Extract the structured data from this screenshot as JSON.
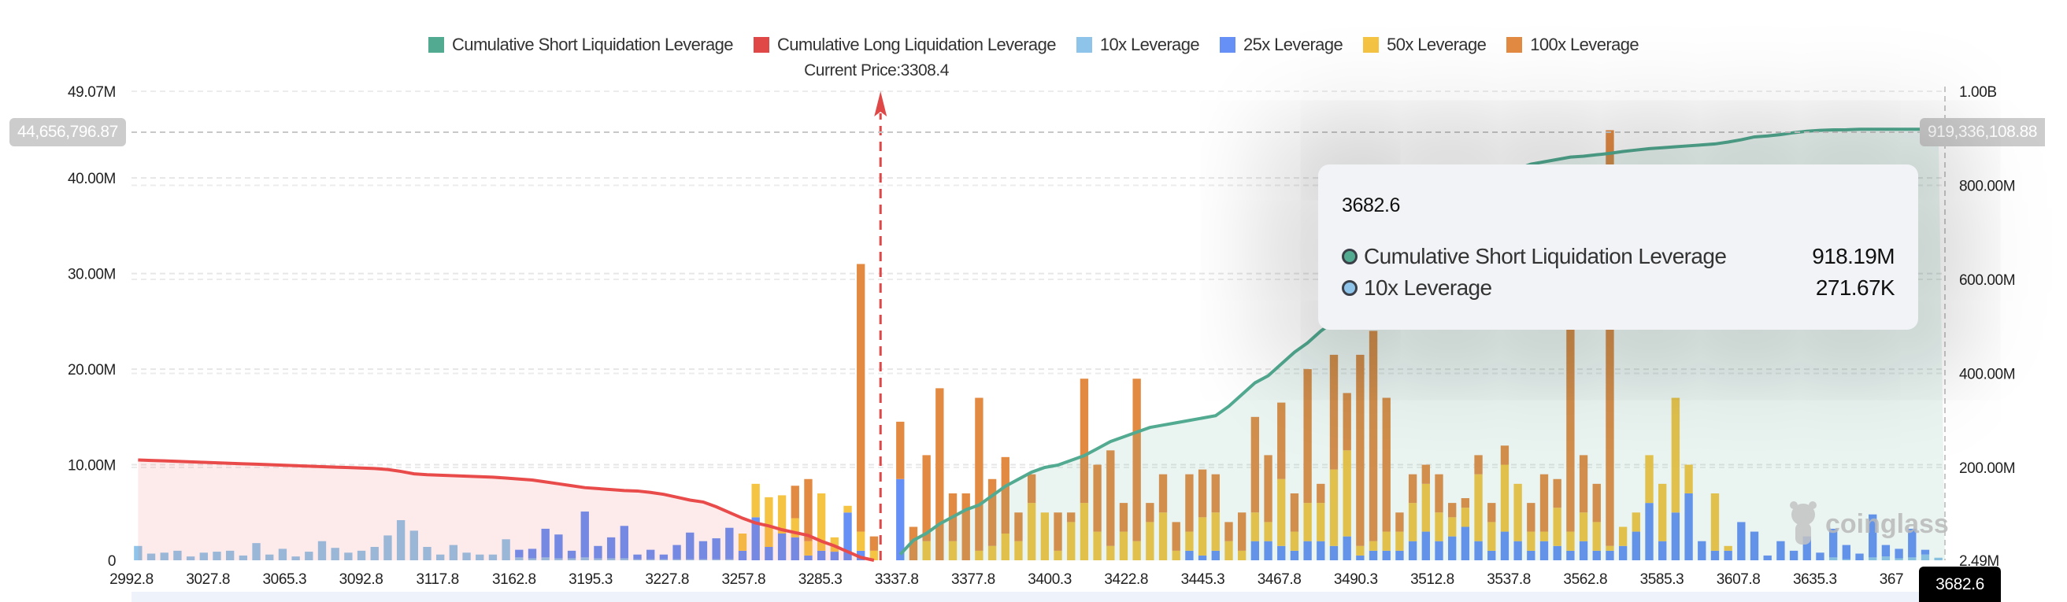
{
  "chart_data": {
    "type": "bar",
    "stacked": true,
    "legend_position": "top",
    "legend": [
      {
        "label": "Cumulative Short Liquidation Leverage",
        "color": "#52ab91"
      },
      {
        "label": "Cumulative Long Liquidation Leverage",
        "color": "#e04848"
      },
      {
        "label": "10x Leverage",
        "color": "#8fc4ea"
      },
      {
        "label": "25x Leverage",
        "color": "#6690f5"
      },
      {
        "label": "50x Leverage",
        "color": "#f5c443"
      },
      {
        "label": "100x Leverage",
        "color": "#e38a42"
      }
    ],
    "current_price_label": "Current Price:3308.4",
    "left_axis": {
      "ticks": [
        "0",
        "10.00M",
        "20.00M",
        "30.00M",
        "40.00M",
        "49.07M"
      ],
      "values": [
        0,
        10,
        20,
        30,
        40,
        49.07
      ],
      "range": [
        0,
        49.07
      ],
      "unit": "M"
    },
    "right_axis": {
      "ticks": [
        "2.49M",
        "200.00M",
        "400.00M",
        "600.00M",
        "800.00M",
        "1.00B"
      ],
      "values": [
        2.49,
        200,
        400,
        600,
        800,
        1000
      ],
      "range": [
        2.49,
        1000
      ],
      "unit": "M"
    },
    "x_ticks": [
      "2992.8",
      "3027.8",
      "3065.3",
      "3092.8",
      "3117.8",
      "3162.8",
      "3195.3",
      "3227.8",
      "3257.8",
      "3285.3",
      "3337.8",
      "3377.8",
      "3400.3",
      "3422.8",
      "3445.3",
      "3467.8",
      "3490.3",
      "3512.8",
      "3537.8",
      "3562.8",
      "3585.3",
      "3607.8",
      "3635.3",
      "367"
    ],
    "grid": true,
    "crosshair": {
      "x_label": "3682.6",
      "left_value": "44,656,796.87",
      "right_value": "919,336,108.88"
    },
    "series": [
      {
        "name": "10x Leverage",
        "axis": "left",
        "values": [
          1.5,
          0.7,
          0.8,
          1,
          0.4,
          0.8,
          0.9,
          1,
          0.5,
          1.8,
          0.6,
          1.2,
          0.4,
          0.9,
          2,
          1.3,
          0.8,
          1,
          1.4,
          2.6,
          4.2,
          3.1,
          1.4,
          0.6,
          1.6,
          0.8,
          0.6,
          0.6,
          2.2,
          0.3,
          0.2,
          0.3,
          0.2,
          0.2,
          0.3,
          0.2,
          0.2,
          0.2,
          0.1,
          0.1,
          0.1,
          0.1,
          0.1,
          0.1,
          0.1,
          0.1,
          0,
          0,
          0,
          0,
          0,
          0,
          0,
          0,
          0,
          0,
          0,
          0,
          0,
          0,
          0,
          0,
          0,
          0,
          0,
          0,
          0,
          0,
          0,
          0,
          0,
          0,
          0,
          0,
          0,
          0,
          0,
          0,
          0,
          0,
          0,
          0,
          0,
          0,
          0,
          0,
          0,
          0,
          0,
          0,
          0,
          0,
          0,
          0,
          0,
          0,
          0,
          0,
          0,
          0,
          0,
          0,
          0,
          0,
          0,
          0,
          0,
          0,
          0,
          0,
          0,
          0,
          0,
          0,
          0,
          0,
          0,
          0,
          0,
          0,
          0,
          0,
          0,
          0,
          0,
          0,
          0,
          0,
          0,
          0.3,
          0.1,
          0,
          0.3,
          0.4,
          0.2,
          0.3,
          0.6,
          0.27
        ]
      },
      {
        "name": "25x Leverage",
        "axis": "left",
        "values": [
          0,
          0,
          0,
          0,
          0,
          0,
          0,
          0,
          0,
          0,
          0,
          0,
          0,
          0,
          0,
          0,
          0,
          0,
          0,
          0,
          0,
          0,
          0,
          0,
          0,
          0,
          0,
          0,
          0,
          0.8,
          1,
          3,
          2.5,
          0.8,
          4.8,
          1.3,
          2.2,
          3.4,
          0.5,
          1,
          0.5,
          1.5,
          2.8,
          1.9,
          2.2,
          3.3,
          1,
          4.5,
          1.4,
          2.8,
          2.4,
          0.5,
          1,
          0.9,
          5,
          1,
          0,
          0,
          8.5,
          0,
          0,
          0,
          0,
          0,
          0,
          0,
          0,
          0,
          0,
          0,
          0,
          0,
          0,
          0,
          0,
          0,
          0,
          0,
          0,
          0,
          1,
          0.5,
          1,
          0,
          0,
          2,
          2,
          1.5,
          1,
          2,
          2,
          1.5,
          2.5,
          0.5,
          1,
          1,
          1,
          2,
          3,
          2,
          2.5,
          3.5,
          2,
          1,
          3,
          2,
          1,
          2,
          1.5,
          1,
          2,
          1,
          1,
          1.5,
          3,
          6,
          2,
          5,
          7,
          2,
          1,
          1,
          4,
          3,
          0.5,
          2,
          1,
          2.5,
          0.8,
          3,
          1.5,
          0.7,
          4.5,
          1.2,
          1,
          3,
          0.5,
          0
        ]
      },
      {
        "name": "50x Leverage",
        "axis": "left",
        "values": [
          0,
          0,
          0,
          0,
          0,
          0,
          0,
          0,
          0,
          0,
          0,
          0,
          0,
          0,
          0,
          0,
          0,
          0,
          0,
          0,
          0,
          0,
          0,
          0,
          0,
          0,
          0,
          0,
          0,
          0,
          0,
          0,
          0,
          0,
          0,
          0,
          0,
          0,
          0,
          0,
          0,
          0,
          0,
          0,
          0,
          0,
          1.8,
          3.5,
          5.2,
          4,
          2,
          1.5,
          6,
          1.5,
          0.7,
          2,
          1,
          0,
          0,
          0,
          2,
          0,
          2,
          0,
          1,
          1.5,
          2.8,
          2,
          6,
          5,
          1,
          4,
          6,
          3,
          1.5,
          3,
          2,
          4,
          5,
          1,
          2,
          4,
          4,
          2,
          1,
          3,
          2,
          7,
          2,
          4,
          4,
          8,
          9,
          1,
          1,
          2,
          2,
          4,
          5,
          3,
          2,
          2,
          7,
          3,
          7,
          6,
          2,
          1,
          4,
          2,
          3,
          3,
          0.5,
          2,
          2,
          5,
          6,
          12,
          3,
          0,
          6,
          0.5,
          0,
          0,
          0,
          0,
          0,
          0,
          0,
          0,
          0,
          0,
          0,
          0,
          0,
          0,
          0,
          0
        ]
      },
      {
        "name": "100x Leverage",
        "axis": "left",
        "values": [
          0,
          0,
          0,
          0,
          0,
          0,
          0,
          0,
          0,
          0,
          0,
          0,
          0,
          0,
          0,
          0,
          0,
          0,
          0,
          0,
          0,
          0,
          0,
          0,
          0,
          0,
          0,
          0,
          0,
          0,
          0,
          0,
          0,
          0,
          0,
          0,
          0,
          0,
          0,
          0,
          0,
          0,
          0,
          0,
          0,
          0,
          0,
          0,
          0,
          0,
          3.4,
          6.5,
          0,
          0,
          0,
          28,
          1.5,
          0,
          6,
          3.5,
          9,
          18,
          5,
          7,
          16,
          7,
          8,
          3,
          3,
          0,
          4,
          1,
          13,
          7,
          10,
          3,
          17,
          2,
          4,
          3,
          6,
          5,
          4,
          2,
          4,
          10,
          7,
          8,
          4,
          14,
          2,
          12,
          6,
          20,
          22,
          14,
          2,
          3,
          2,
          4,
          1.5,
          1,
          2,
          2,
          2,
          0,
          3,
          6,
          3,
          22,
          6,
          4,
          43.5,
          0,
          0,
          0,
          0,
          0,
          0,
          0,
          0,
          0,
          0,
          0,
          0,
          0,
          0,
          0,
          0,
          0,
          0,
          0,
          0,
          0,
          0,
          0
        ]
      },
      {
        "name": "Cumulative Long Liquidation Leverage",
        "axis": "left",
        "type": "line",
        "values": [
          10.5,
          10.45,
          10.4,
          10.35,
          10.3,
          10.25,
          10.2,
          10.15,
          10.1,
          10.05,
          10,
          9.95,
          9.9,
          9.85,
          9.8,
          9.75,
          9.7,
          9.65,
          9.6,
          9.5,
          9.3,
          9.05,
          8.95,
          8.9,
          8.85,
          8.8,
          8.75,
          8.7,
          8.6,
          8.5,
          8.4,
          8.2,
          8.0,
          7.8,
          7.6,
          7.5,
          7.4,
          7.3,
          7.25,
          7.1,
          6.9,
          6.6,
          6.3,
          6.1,
          5.6,
          5.0,
          4.4,
          3.9,
          3.6,
          3.2,
          2.9,
          2.6,
          2.0,
          1.5,
          0.9,
          0.3,
          0
        ]
      },
      {
        "name": "Cumulative Short Liquidation Leverage",
        "axis": "right",
        "type": "line",
        "start_index": 58,
        "values": [
          15,
          45,
          60,
          80,
          95,
          110,
          120,
          140,
          160,
          175,
          190,
          200,
          205,
          215,
          225,
          240,
          255,
          265,
          275,
          285,
          290,
          295,
          300,
          305,
          310,
          330,
          355,
          380,
          395,
          420,
          445,
          465,
          490,
          510,
          530,
          560,
          600,
          640,
          680,
          720,
          760,
          785,
          795,
          800,
          805,
          810,
          820,
          835,
          845,
          850,
          855,
          860,
          862,
          865,
          868,
          872,
          875,
          878,
          880,
          882,
          884,
          886,
          888,
          892,
          897,
          903,
          905,
          908,
          912,
          915,
          917,
          918,
          918.19,
          919.34,
          919.34,
          919.34,
          919.34,
          919.34,
          919.34,
          919.34
        ]
      }
    ]
  },
  "tooltip": {
    "title": "3682.6",
    "rows": [
      {
        "label": "Cumulative Short Liquidation Leverage",
        "value": "918.19M",
        "color": "#52ab91"
      },
      {
        "label": "10x Leverage",
        "value": "271.67K",
        "color": "#8fc4ea"
      }
    ]
  },
  "watermark": "coinglass"
}
